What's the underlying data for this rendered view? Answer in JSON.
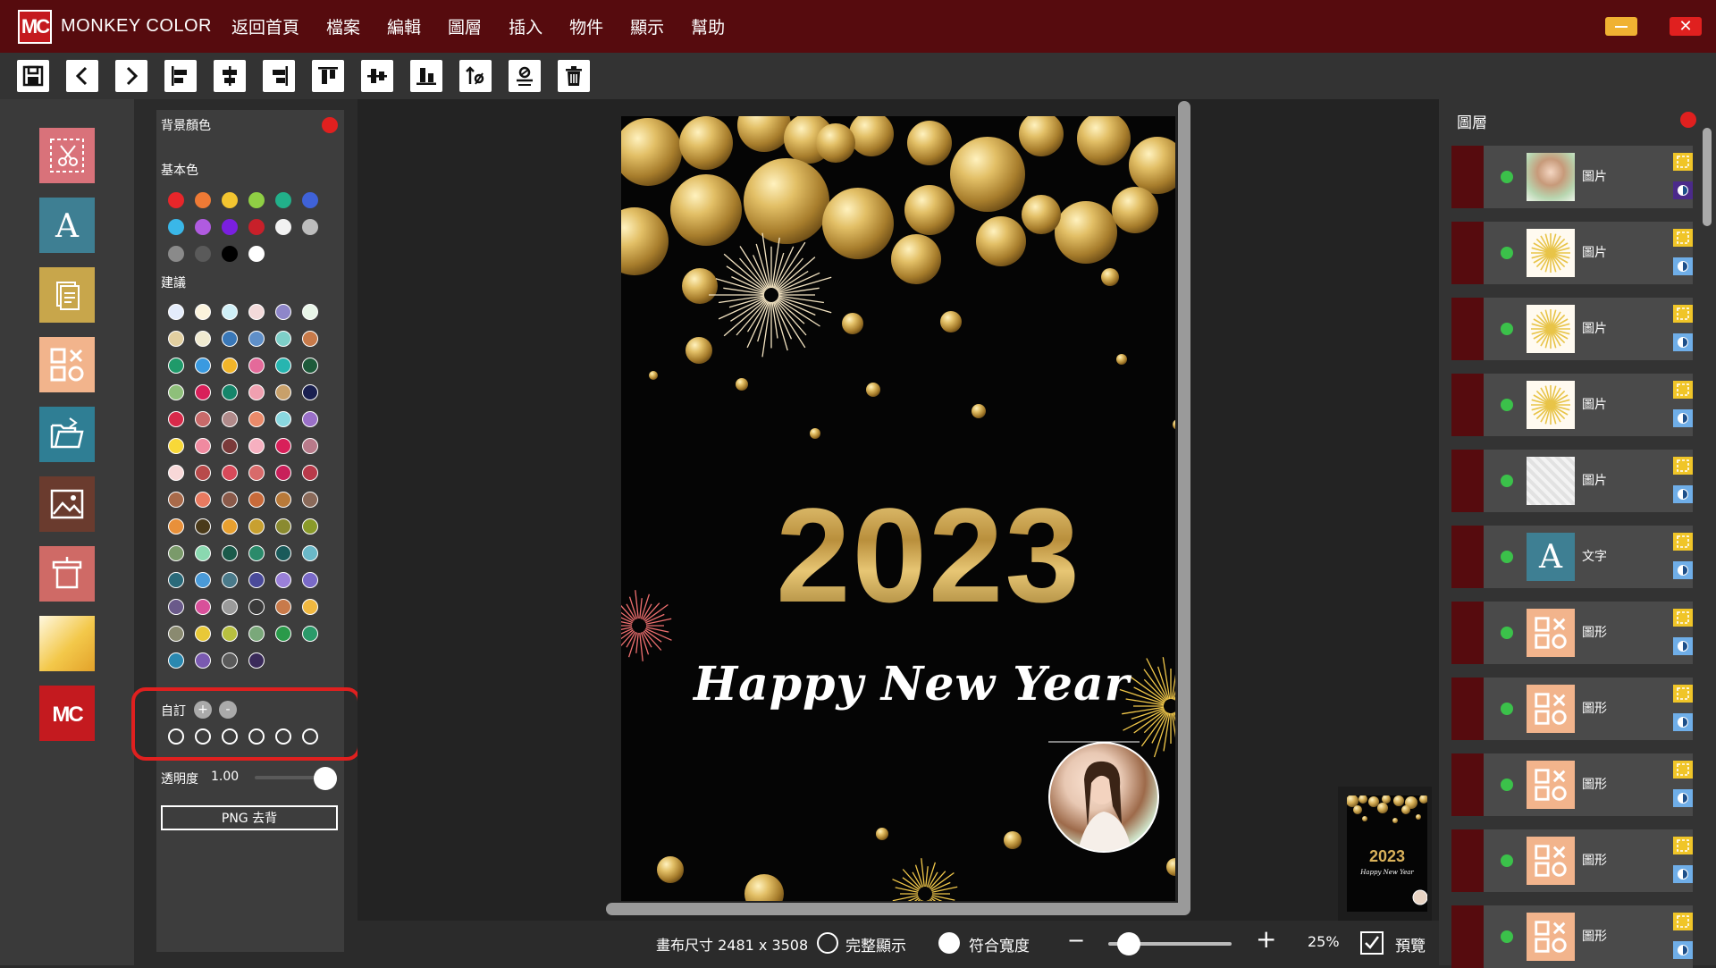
{
  "app": {
    "logo_text": "MC",
    "name": "MONKEY COLOR",
    "menu": [
      "返回首頁",
      "檔案",
      "編輯",
      "圖層",
      "插入",
      "物件",
      "顯示",
      "幫助"
    ],
    "close_glyph": "✕"
  },
  "toolbar": {
    "buttons": [
      "save-icon",
      "undo-icon",
      "redo-icon",
      "align-left-icon",
      "align-center-h-icon",
      "align-right-icon",
      "align-top-icon",
      "align-middle-v-icon",
      "align-bottom-icon",
      "layer-order-icon",
      "flip-icon",
      "trash-icon"
    ]
  },
  "left_tools": [
    "crop-cut-icon",
    "text-icon",
    "document-icon",
    "shapes-icon",
    "open-folder-icon",
    "image-icon",
    "frame-icon",
    "gradient-icon",
    "mc-logo-icon"
  ],
  "color_panel": {
    "bg_color_label": "背景顏色",
    "basic_label": "基本色",
    "suggested_label": "建議",
    "custom_label": "自訂",
    "custom_add": "+",
    "custom_remove": "-",
    "opacity_label": "透明度",
    "opacity_value": "1.00",
    "png_remove_label": "PNG 去背",
    "basic_colors": [
      "#e8262a",
      "#ef7a35",
      "#f3c530",
      "#8fcf44",
      "#22b08a",
      "#3f62d8",
      "#3ab7e8",
      "#b05be0",
      "#7a1fe0",
      "#c8202a",
      "#f2f2f2",
      "#bdbdbd",
      "#8a8a8a",
      "#5a5a5a",
      "#000000",
      "#ffffff"
    ],
    "suggested_colors": [
      [
        "#e4ecfb",
        "#fbf3dc",
        "#cfeff7",
        "#f3dada",
        "#8e86c9",
        "#e8f5e8"
      ],
      [
        "#e2cfa0",
        "#f0ead0",
        "#3a78b8",
        "#5f8fc8",
        "#7ecfc8",
        "#c77a4a"
      ],
      [
        "#1f9a6a",
        "#3a9ae0",
        "#f2b52a",
        "#e46a9a",
        "#27b5b0",
        "#1d5a3a"
      ],
      [
        "#8ebf7a",
        "#d8205a",
        "#15856a",
        "#f0a0b0",
        "#c8a06a",
        "#1a2050"
      ],
      [
        "#d82a4a",
        "#c86a6a",
        "#b08a8a",
        "#ea8a6a",
        "#8ad8e0",
        "#9a70c8"
      ],
      [
        "#f8d838",
        "#f08aa0",
        "#7a3a3a",
        "#f6b0c0",
        "#d8205a",
        "#b87a8a"
      ],
      [
        "#f8d8d8",
        "#b84a4a",
        "#d84a5a",
        "#d86a6a",
        "#c8205a",
        "#b83a4a"
      ],
      [
        "#a86a4a",
        "#e87a60",
        "#8a5a4a",
        "#c86a3a",
        "#b87a3a",
        "#8a6a5a"
      ],
      [
        "#e8903a",
        "#4a3a1a",
        "#e8a030",
        "#c8a030",
        "#8a8a30",
        "#8a9a2a"
      ],
      [
        "#7a9a6a",
        "#8ad8b0",
        "#1a5a4a",
        "#2a8a6a",
        "#1a5a5a",
        "#6ab8c8"
      ],
      [
        "#2a6a7a",
        "#4a9ad8",
        "#4a7a8a",
        "#4a4a9a",
        "#9a80d8",
        "#7a6ac8"
      ],
      [
        "#6a5a8a",
        "#d8509a",
        "#9a9a9a",
        "#3a3a3a",
        "#c87a4a",
        "#f0b840"
      ],
      [
        "#8a8a70",
        "#e8c838",
        "#b8c040",
        "#7aa87a",
        "#2a9a4a",
        "#2a9a6a"
      ],
      [
        "#2a88b0",
        "#7a5ab0",
        "#5a5a5a",
        "#3a2a5a"
      ]
    ],
    "custom_slots": 6
  },
  "canvas": {
    "year_text": "2023",
    "greeting_text": "Happy New Year",
    "bubble_color": "#c9a24a"
  },
  "bottom_bar": {
    "canvas_size_label": "畫布尺寸 2481 x 3508",
    "fit_all_label": "完整顯示",
    "fit_width_label": "符合寬度",
    "zoom_minus": "−",
    "zoom_plus": "+",
    "zoom_value": "25%",
    "preview_label": "預覽",
    "preview_checked": true
  },
  "layers": {
    "title": "圖層",
    "items": [
      {
        "name": "圖片",
        "thumb": "portrait"
      },
      {
        "name": "圖片",
        "thumb": "burst"
      },
      {
        "name": "圖片",
        "thumb": "burst"
      },
      {
        "name": "圖片",
        "thumb": "burst"
      },
      {
        "name": "圖片",
        "thumb": "pattern"
      },
      {
        "name": "文字",
        "thumb": "text"
      },
      {
        "name": "圖形",
        "thumb": "shape"
      },
      {
        "name": "圖形",
        "thumb": "shape"
      },
      {
        "name": "圖形",
        "thumb": "shape"
      },
      {
        "name": "圖形",
        "thumb": "shape"
      },
      {
        "name": "圖形",
        "thumb": "shape"
      }
    ]
  },
  "colors": {
    "accent_red": "#e0201f",
    "menubar": "#560b0e",
    "gold": "#c9a24a",
    "visibility_green": "#3bc14a"
  }
}
